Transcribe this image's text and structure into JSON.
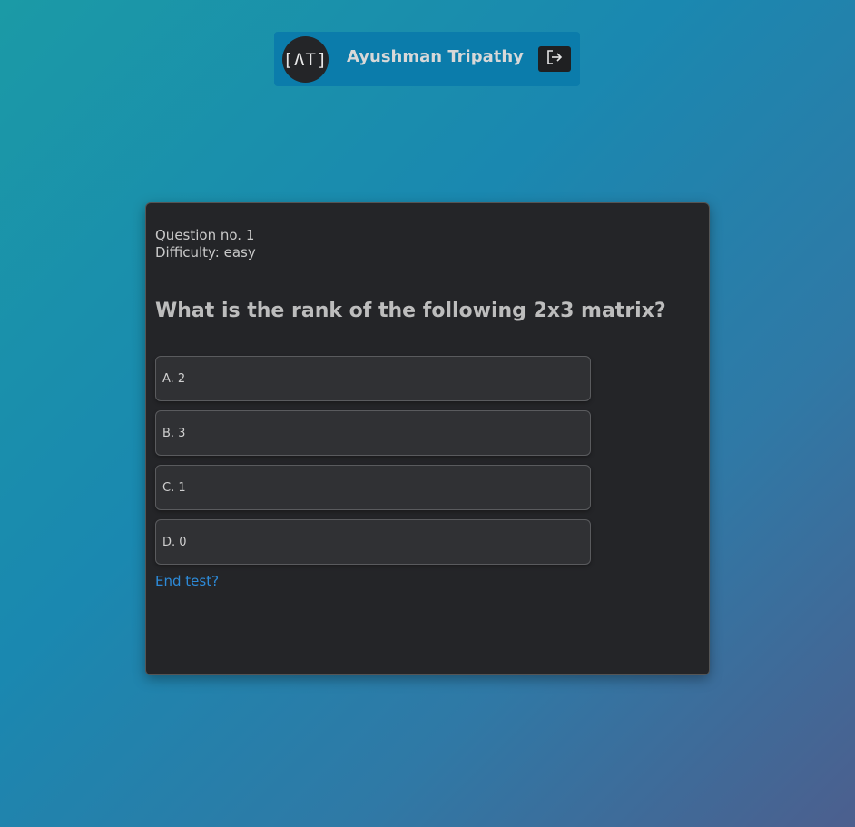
{
  "header": {
    "avatar_text": "[ΛT]",
    "user_name": "Ayushman Tripathy",
    "logout_icon": "logout-icon"
  },
  "quiz": {
    "question_number": "Question no. 1",
    "difficulty": "Difficulty: easy",
    "question_text": "What is the rank of the following 2x3 matrix?",
    "options": [
      {
        "label": "A. 2"
      },
      {
        "label": "B. 3"
      },
      {
        "label": "C. 1"
      },
      {
        "label": "D. 0"
      }
    ],
    "end_test_label": "End test?"
  },
  "colors": {
    "accent_link": "#2d8ad8",
    "card_background": "#242528",
    "header_background": "#0b7cab"
  }
}
